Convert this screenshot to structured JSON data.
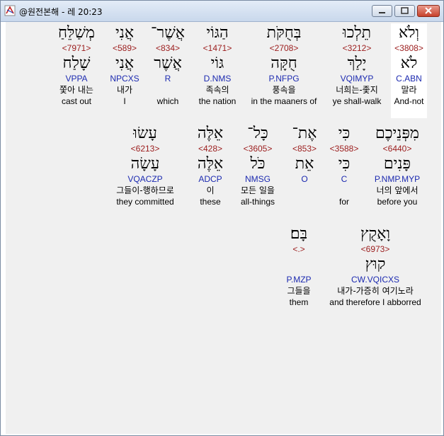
{
  "window": {
    "title": "@원전본해 - 레 20:23"
  },
  "rows": [
    [
      {
        "heb": "וְלֹא",
        "num": "<3808>",
        "lemma": "לֹא",
        "gram": "C.ABN",
        "kor": "말라",
        "eng": "And-not"
      },
      {
        "heb": "תֵלְכוּ",
        "num": "<3212>",
        "lemma": "יָלַךְ",
        "gram": "VQIMYP",
        "kor": "너희는-좇지",
        "eng": "ye shall-walk"
      },
      {
        "heb": "בְּחֻקֹּת",
        "num": "<2708>",
        "lemma": "חֻקָּה",
        "gram": "P.NFPG",
        "kor": "풍속을",
        "eng": "in the maaners of"
      },
      {
        "heb": "הַגּוֹי",
        "num": "<1471>",
        "lemma": "גּוֹי",
        "gram": "D.NMS",
        "kor": "족속의",
        "eng": "the nation"
      },
      {
        "heb": "אֲשֶׁר־",
        "num": "<834>",
        "lemma": "אֲשֶׁר",
        "gram": "R",
        "kor": "",
        "eng": "which"
      },
      {
        "heb": "אֲנִי",
        "num": "<589>",
        "lemma": "אֲנִי",
        "gram": "NPCXS",
        "kor": "내가",
        "eng": "I"
      },
      {
        "heb": "מְשַׁלֵּחַ",
        "num": "<7971>",
        "lemma": "שָׁלַח",
        "gram": "VPPA",
        "kor": "쫓아 내는",
        "eng": "cast out"
      }
    ],
    [
      {
        "heb": "מִפְּנֵיכֶם",
        "num": "<6440>",
        "lemma": "פָּנִים",
        "gram": "P.NMP.MYP",
        "kor": "너의 앞에서",
        "eng": "before you"
      },
      {
        "heb": "כִּי",
        "num": "<3588>",
        "lemma": "כִּי",
        "gram": "C",
        "kor": "",
        "eng": "for"
      },
      {
        "heb": "אֶת־",
        "num": "<853>",
        "lemma": "אֵת",
        "gram": "O",
        "kor": "",
        "eng": ""
      },
      {
        "heb": "כָּל־",
        "num": "<3605>",
        "lemma": "כֹּל",
        "gram": "NMSG",
        "kor": "모든 일을",
        "eng": "all-things"
      },
      {
        "heb": "אֵלֶּה",
        "num": "<428>",
        "lemma": "אֵלֶּה",
        "gram": "ADCP",
        "kor": "이",
        "eng": "these"
      },
      {
        "heb": "עָשׂוּ",
        "num": "<6213>",
        "lemma": "עָשָׂה",
        "gram": "VQACZP",
        "kor": "그들이-행하므로",
        "eng": "they committed"
      }
    ],
    [
      {
        "heb": "וָאָקֻץ",
        "num": "<6973>",
        "lemma": "קוּץ",
        "gram": "CW.VQICXS",
        "kor": "내가-가증히 여기노라",
        "eng": "and therefore I abborred"
      },
      {
        "heb": "בָּם׃",
        "num": "<.>",
        "lemma": "",
        "gram": "P.MZP",
        "kor": "그들을",
        "eng": "them"
      }
    ]
  ]
}
